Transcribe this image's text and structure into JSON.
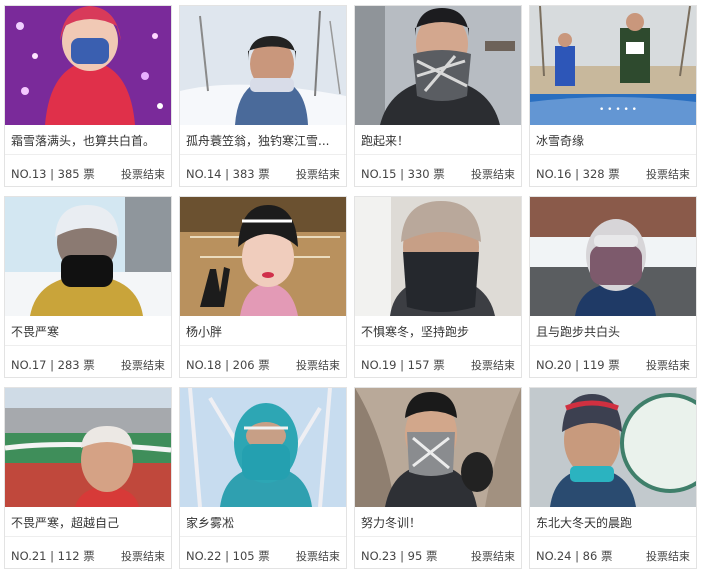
{
  "cards": [
    {
      "title": "霜雪落满头，也算共白首。",
      "no": "NO.13",
      "votes": "385 票",
      "status": "投票结束"
    },
    {
      "title": "孤舟蓑笠翁，独钓寒江雪...",
      "no": "NO.14",
      "votes": "383 票",
      "status": "投票结束"
    },
    {
      "title": "跑起来！",
      "no": "NO.15",
      "votes": "330 票",
      "status": "投票结束"
    },
    {
      "title": "冰雪奇缘",
      "no": "NO.16",
      "votes": "328 票",
      "status": "投票结束"
    },
    {
      "title": "不畏严寒",
      "no": "NO.17",
      "votes": "283 票",
      "status": "投票结束"
    },
    {
      "title": "杨小胖",
      "no": "NO.18",
      "votes": "206 票",
      "status": "投票结束"
    },
    {
      "title": "不惧寒冬，坚持跑步",
      "no": "NO.19",
      "votes": "157 票",
      "status": "投票结束"
    },
    {
      "title": "且与跑步共白头",
      "no": "NO.20",
      "votes": "119 票",
      "status": "投票结束"
    },
    {
      "title": "不畏严寒，超越自己",
      "no": "NO.21",
      "votes": "112 票",
      "status": "投票结束"
    },
    {
      "title": "家乡雾凇",
      "no": "NO.22",
      "votes": "105 票",
      "status": "投票结束"
    },
    {
      "title": "努力冬训！",
      "no": "NO.23",
      "votes": "95 票",
      "status": "投票结束"
    },
    {
      "title": "东北大冬天的晨跑",
      "no": "NO.24",
      "votes": "86 票",
      "status": "投票结束"
    }
  ],
  "separator": " | "
}
